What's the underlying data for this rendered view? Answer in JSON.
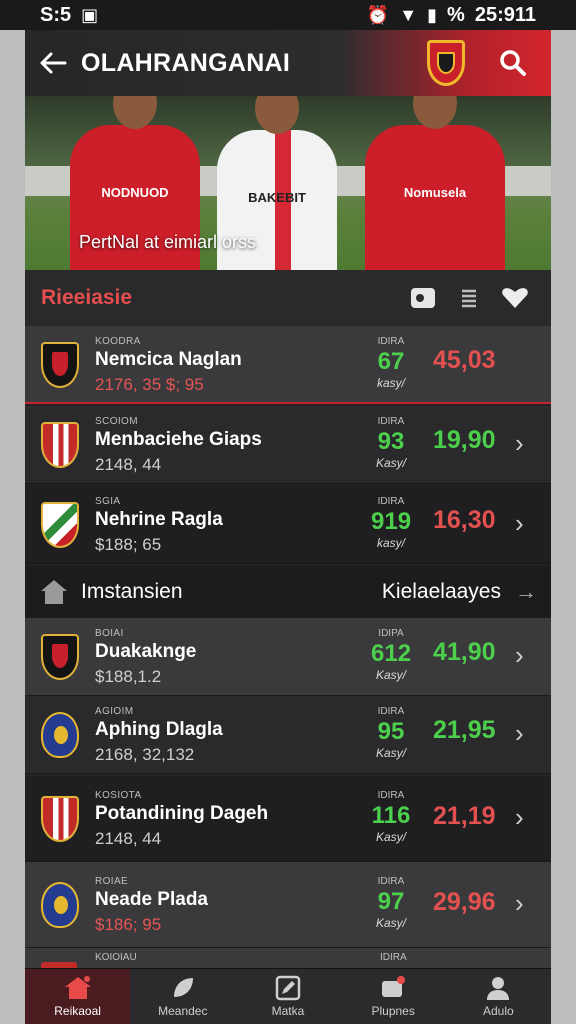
{
  "status_bar": {
    "time": "S:5",
    "right_time": "25:911",
    "battery_text": "%"
  },
  "app_bar": {
    "title": "OLAHRANGANAI"
  },
  "hero": {
    "caption": "PertNal at eimiarl orss",
    "shirt_texts": [
      "NODNUOD",
      "BAKEBIT",
      "Nomusela"
    ]
  },
  "section": {
    "title": "Rieeiasie"
  },
  "rows": [
    {
      "code": "KOODRA",
      "name": "Nemcica Naglan",
      "sub": "2176, 35 $; 95",
      "sub_color": "red",
      "stat_label": "IDIRA",
      "stat": "67",
      "stat_unit": "kasy/",
      "price": "45,03",
      "price_color": "red",
      "crest": "black",
      "chevron": false
    },
    {
      "code": "SCOIOM",
      "name": "Menbaciehe Giaps",
      "sub": "2148, 44",
      "sub_color": "normal",
      "stat_label": "IDIRA",
      "stat": "93",
      "stat_unit": "Kasy/",
      "price": "19,90",
      "price_color": "green",
      "crest": "red",
      "chevron": true
    },
    {
      "code": "SGIA",
      "name": "Nehrine Ragla",
      "sub": "$188; 65",
      "sub_color": "normal",
      "stat_label": "IDIRA",
      "stat": "919",
      "stat_unit": "kasy/",
      "price": "16,30",
      "price_color": "red",
      "crest": "green",
      "chevron": true
    },
    {
      "code": "BOIAI",
      "name": "Duakaknge",
      "sub": "$188,1.2",
      "sub_color": "normal",
      "stat_label": "IDIPA",
      "stat": "612",
      "stat_unit": "Kasy/",
      "price": "41,90",
      "price_color": "green",
      "crest": "black",
      "chevron": true
    },
    {
      "code": "AGIOIM",
      "name": "Aphing Dlagla",
      "sub": "2168, 32,132",
      "sub_color": "normal",
      "stat_label": "IDIRA",
      "stat": "95",
      "stat_unit": "Kasy/",
      "price": "21,95",
      "price_color": "green",
      "crest": "blue",
      "chevron": true
    },
    {
      "code": "KOSIOTA",
      "name": "Potandining Dageh",
      "sub": "2148, 44",
      "sub_color": "normal",
      "stat_label": "IDIRA",
      "stat": "116",
      "stat_unit": "Kasy/",
      "price": "21,19",
      "price_color": "red",
      "crest": "red",
      "chevron": true
    },
    {
      "code": "ROIAE",
      "name": "Neade Plada",
      "sub": "$186; 95",
      "sub_color": "red",
      "stat_label": "IDIRA",
      "stat": "97",
      "stat_unit": "Kasy/",
      "price": "29,96",
      "price_color": "red",
      "crest": "blue",
      "chevron": true
    }
  ],
  "sub_header": {
    "title": "Imstansien",
    "link": "Kielaelaayes"
  },
  "peek_row": {
    "code": "KOIOIAU",
    "stat_label": "IDIRA"
  },
  "bottom_nav": [
    {
      "label": "Reikaoal",
      "icon": "home-icon",
      "active": true
    },
    {
      "label": "Meandec",
      "icon": "leaf-icon",
      "active": false
    },
    {
      "label": "Matka",
      "icon": "edit-icon",
      "active": false
    },
    {
      "label": "Plupnes",
      "icon": "thumb-icon",
      "active": false
    },
    {
      "label": "Adulo",
      "icon": "user-icon",
      "active": false
    }
  ],
  "colors": {
    "accent": "#d3252e",
    "up": "#4cd04c",
    "down": "#e35050"
  }
}
